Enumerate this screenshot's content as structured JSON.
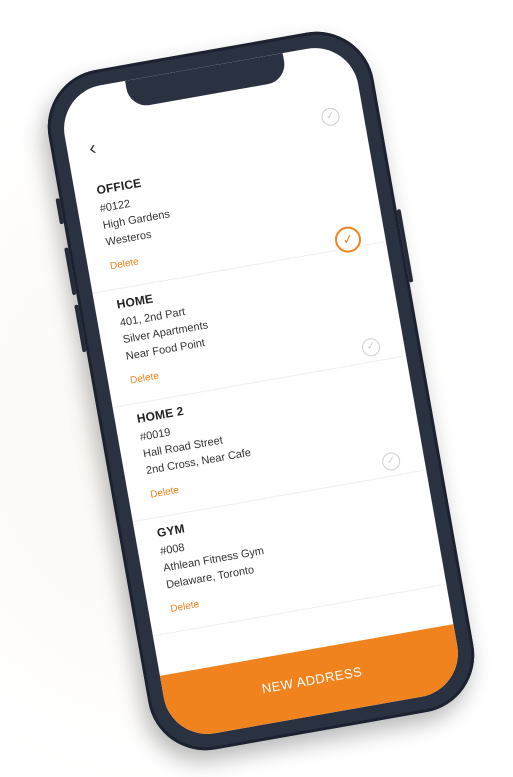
{
  "header": {
    "back_icon": "chevron-left-icon"
  },
  "addresses": [
    {
      "title": "OFFICE",
      "lines": [
        "#0122",
        "High Gardens",
        "Westeros"
      ],
      "delete_label": "Delete",
      "selected": false
    },
    {
      "title": "HOME",
      "lines": [
        "401, 2nd Part",
        "Silver Apartments",
        "Near Food Point"
      ],
      "delete_label": "Delete",
      "selected": true
    },
    {
      "title": "HOME 2",
      "lines": [
        "#0019",
        "Hall Road Street",
        "2nd Cross, Near Cafe"
      ],
      "delete_label": "Delete",
      "selected": false
    },
    {
      "title": "GYM",
      "lines": [
        "#008",
        "Athlean Fitness Gym",
        "Delaware, Toronto"
      ],
      "delete_label": "Delete",
      "selected": false
    }
  ],
  "footer": {
    "new_address_label": "NEW ADDRESS"
  },
  "colors": {
    "accent": "#f0831e",
    "phone_body": "#2a3140"
  },
  "icons": {
    "check": "check-circle-icon"
  }
}
